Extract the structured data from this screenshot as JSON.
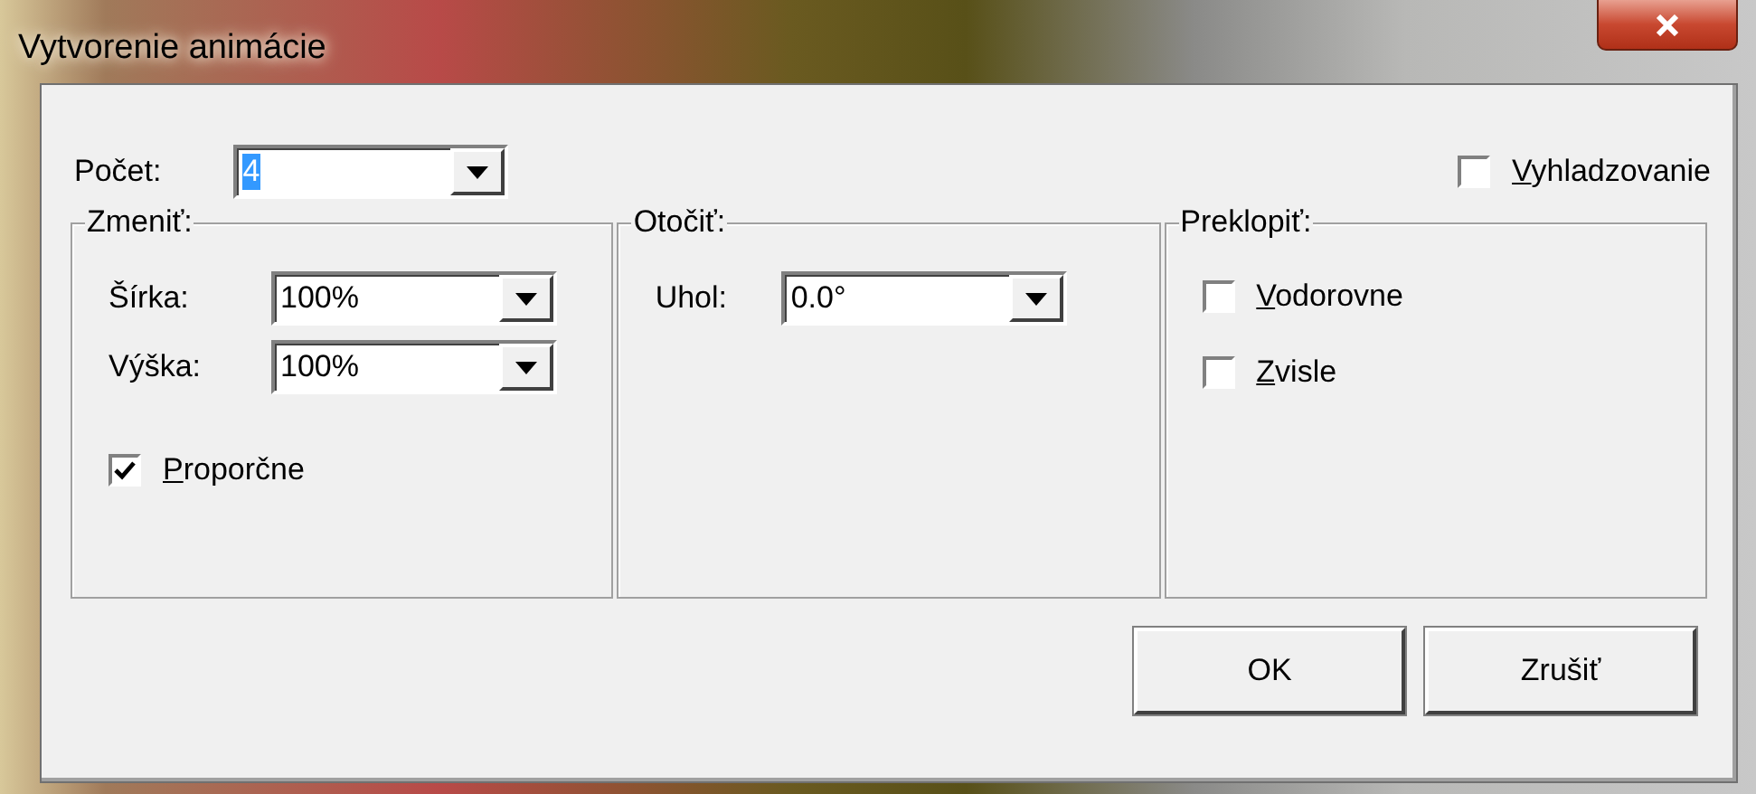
{
  "window": {
    "title": "Vytvorenie animácie"
  },
  "count": {
    "label": "Počet:",
    "value": "4",
    "value_selected": true
  },
  "smoothing": {
    "label": "Vyhladzovanie",
    "checked": false
  },
  "groups": [
    {
      "kind": "resize",
      "title": "Zmeniť:",
      "fields": [
        {
          "label": "Šírka:",
          "value": "100%"
        },
        {
          "label": "Výška:",
          "value": "100%"
        }
      ],
      "checkboxes": [
        {
          "label": "Proporčne",
          "checked": true
        }
      ]
    },
    {
      "kind": "rotate",
      "title": "Otočiť:",
      "fields": [
        {
          "label": "Uhol:",
          "value": "0.0°"
        }
      ]
    },
    {
      "kind": "flip",
      "title": "Preklopiť:",
      "checkboxes": [
        {
          "label": "Vodorovne",
          "checked": false
        },
        {
          "label": "Zvisle",
          "checked": false
        }
      ]
    }
  ],
  "buttons": [
    {
      "label": "OK"
    },
    {
      "label": "Zrušiť"
    }
  ]
}
